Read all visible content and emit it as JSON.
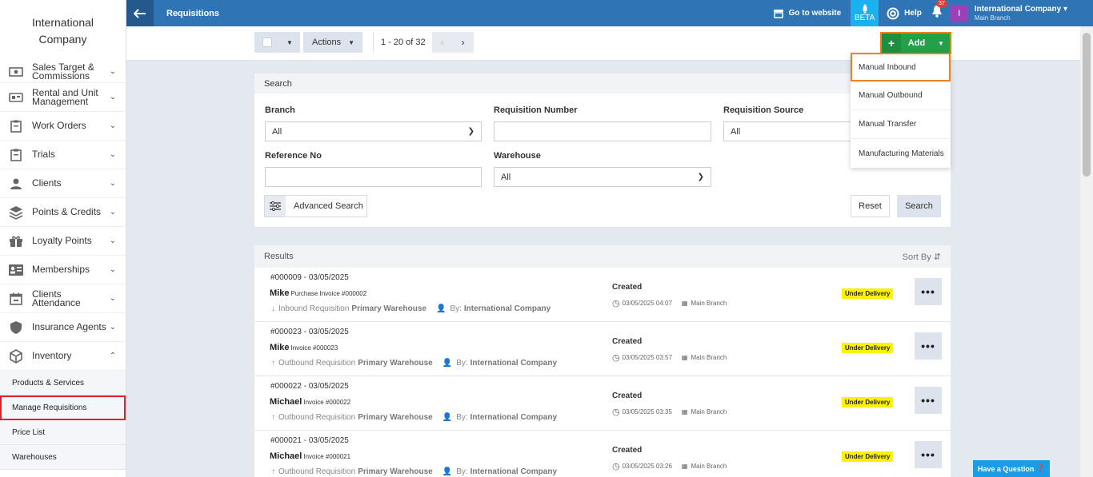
{
  "brand": {
    "name": "International Company"
  },
  "header": {
    "title": "Requisitions",
    "go_to_website": "Go to website",
    "beta": "BETA",
    "help": "Help",
    "notifications_count": "37",
    "avatar_initial": "I",
    "company_name": "International Company",
    "company_branch": "Main Branch"
  },
  "sidebar": {
    "items": [
      {
        "label": "Sales Target & Commissions",
        "icon": "money-icon"
      },
      {
        "label": "Rental and Unit Management",
        "icon": "rental-icon"
      },
      {
        "label": "Work Orders",
        "icon": "clipboard-icon"
      },
      {
        "label": "Trials",
        "icon": "clipboard-icon"
      },
      {
        "label": "Clients",
        "icon": "user-icon"
      },
      {
        "label": "Points & Credits",
        "icon": "layers-icon"
      },
      {
        "label": "Loyalty Points",
        "icon": "gift-icon"
      },
      {
        "label": "Memberships",
        "icon": "id-card-icon"
      },
      {
        "label": "Clients Attendance",
        "icon": "calendar-icon"
      },
      {
        "label": "Insurance Agents",
        "icon": "shield-icon"
      },
      {
        "label": "Inventory",
        "icon": "box-icon"
      }
    ],
    "sub_items": [
      "Products & Services",
      "Manage Requisitions",
      "Price List",
      "Warehouses"
    ]
  },
  "toolbar": {
    "actions_label": "Actions",
    "pagination": "1 - 20 of 32",
    "add_label": "Add"
  },
  "add_menu": {
    "items": [
      "Manual Inbound",
      "Manual Outbound",
      "Manual Transfer",
      "Manufacturing Materials"
    ]
  },
  "search": {
    "title": "Search",
    "branch_label": "Branch",
    "branch_value": "All",
    "req_number_label": "Requisition Number",
    "req_number_value": "",
    "req_source_label": "Requisition Source",
    "req_source_value": "All",
    "reference_label": "Reference No",
    "reference_value": "",
    "warehouse_label": "Warehouse",
    "warehouse_value": "All",
    "advanced_label": "Advanced Search",
    "reset_label": "Reset",
    "search_label": "Search"
  },
  "results": {
    "title": "Results",
    "sort_label": "Sort By",
    "rows": [
      {
        "number": "#000009 - 03/05/2025",
        "customer": "Mike",
        "invoice": "Purchase Invoice #000002",
        "direction": "Inbound Requisition",
        "warehouse": "Primary Warehouse",
        "by_label": "By:",
        "by": "International Company",
        "status": "Created",
        "date": "03/05/2025 04:07",
        "branch": "Main Branch",
        "badge": "Under Delivery"
      },
      {
        "number": "#000023 - 03/05/2025",
        "customer": "Mike",
        "invoice": "Invoice #000023",
        "direction": "Outbound Requisition",
        "warehouse": "Primary Warehouse",
        "by_label": "By:",
        "by": "International Company",
        "status": "Created",
        "date": "03/05/2025 03:57",
        "branch": "Main Branch",
        "badge": "Under Delivery"
      },
      {
        "number": "#000022 - 03/05/2025",
        "customer": "Michael",
        "invoice": "Invoice #000022",
        "direction": "Outbound Requisition",
        "warehouse": "Primary Warehouse",
        "by_label": "By:",
        "by": "International Company",
        "status": "Created",
        "date": "03/05/2025 03:35",
        "branch": "Main Branch",
        "badge": "Under Delivery"
      },
      {
        "number": "#000021 - 03/05/2025",
        "customer": "Michael",
        "invoice": "Invoice #000021",
        "direction": "Outbound Requisition",
        "warehouse": "Primary Warehouse",
        "by_label": "By:",
        "by": "International Company",
        "status": "Created",
        "date": "03/05/2025 03:26",
        "branch": "Main Branch",
        "badge": "Under Delivery"
      }
    ]
  },
  "help_widget": {
    "label": "Have a Question"
  },
  "colors": {
    "header": "#2f74b5",
    "add_button": "#24a148",
    "highlight": "#f07f1d",
    "badge": "#fff200",
    "active_outline": "#e0202c"
  }
}
